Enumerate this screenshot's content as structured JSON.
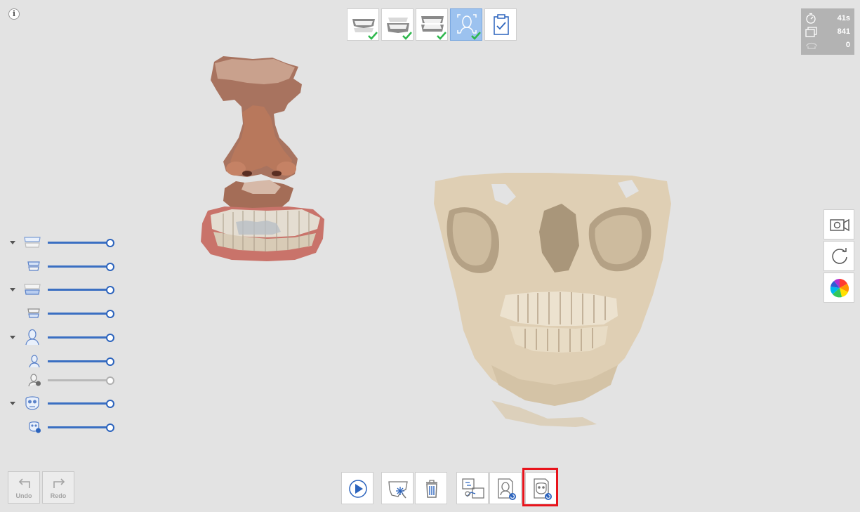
{
  "info": {
    "label": "i"
  },
  "top_toolbar": {
    "steps": [
      {
        "name": "upper-jaw-step",
        "icon": "upper-jaw-icon",
        "completed": true,
        "active": false
      },
      {
        "name": "lower-jaw-step",
        "icon": "lower-jaw-icon",
        "completed": true,
        "active": false
      },
      {
        "name": "occlusion-step",
        "icon": "occlusion-icon",
        "completed": true,
        "active": false
      },
      {
        "name": "face-scan-step",
        "icon": "face-scan-icon",
        "completed": true,
        "active": true
      },
      {
        "name": "review-step",
        "icon": "clipboard-check-icon",
        "completed": false,
        "active": false
      }
    ],
    "check_color": "#2eb84d",
    "active_color": "#9cc2ef"
  },
  "stats": {
    "time": "41s",
    "frames": "841",
    "count": "0"
  },
  "right_tools": [
    {
      "name": "video-record-button",
      "icon": "video-camera-icon"
    },
    {
      "name": "reset-view-button",
      "icon": "rotate-icon"
    },
    {
      "name": "color-map-button",
      "icon": "color-wheel-icon"
    }
  ],
  "layers": [
    {
      "icon": "maxilla-icon",
      "expandable": true,
      "enabled": true,
      "value": 1.0
    },
    {
      "icon": "maxilla-sub-icon",
      "expandable": false,
      "enabled": true,
      "value": 1.0
    },
    {
      "icon": "mandible-icon",
      "expandable": true,
      "enabled": true,
      "value": 1.0
    },
    {
      "icon": "mandible-sub-icon",
      "expandable": false,
      "enabled": true,
      "value": 1.0
    },
    {
      "icon": "face-icon",
      "expandable": true,
      "enabled": true,
      "value": 1.0
    },
    {
      "icon": "face-sub-icon",
      "expandable": false,
      "enabled": true,
      "value": 1.0
    },
    {
      "icon": "face-aligned-icon",
      "expandable": false,
      "enabled": false,
      "value": 1.0
    },
    {
      "icon": "skull-icon",
      "expandable": true,
      "enabled": true,
      "value": 1.0
    },
    {
      "icon": "skull-aligned-icon",
      "expandable": false,
      "enabled": true,
      "value": 1.0
    }
  ],
  "undo_redo": {
    "undo_label": "Undo",
    "redo_label": "Redo"
  },
  "bottom_toolbar": [
    {
      "name": "play-button",
      "icon": "play-icon"
    },
    {
      "name": "lasso-select-button",
      "icon": "lasso-select-icon"
    },
    {
      "name": "delete-button",
      "icon": "trash-icon"
    },
    {
      "name": "align-data-button",
      "icon": "align-icon"
    },
    {
      "name": "face-ct-align-button",
      "icon": "face-align-icon"
    },
    {
      "name": "ct-align-button",
      "icon": "ct-align-icon",
      "highlighted": true
    }
  ],
  "colors": {
    "accent": "#2b63bd",
    "highlight": "#e8141c",
    "background": "#e3e3e3",
    "bone": "#dfcfb4",
    "skin": "#b67a60"
  }
}
